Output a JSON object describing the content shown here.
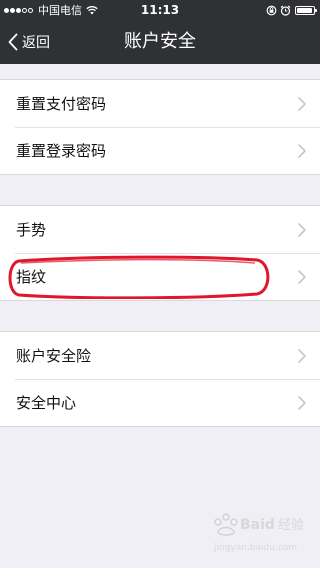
{
  "status_bar": {
    "carrier": "中国电信",
    "time": "11:13",
    "signal_bars_filled": 3,
    "signal_bars_total": 5
  },
  "nav": {
    "back_label": "返回",
    "title": "账户安全"
  },
  "groups": [
    {
      "items": [
        {
          "label": "重置支付密码"
        },
        {
          "label": "重置登录密码"
        }
      ]
    },
    {
      "items": [
        {
          "label": "手势"
        },
        {
          "label": "指纹"
        }
      ]
    },
    {
      "items": [
        {
          "label": "账户安全险"
        },
        {
          "label": "安全中心"
        }
      ]
    }
  ],
  "watermark": {
    "text": "Baidu 经验",
    "url": "jingyan.baidu.com"
  },
  "colors": {
    "header_bg": "#2f3135",
    "page_bg": "#f0eff5",
    "highlight": "#e0162b",
    "chevron": "#c7c7cc"
  }
}
